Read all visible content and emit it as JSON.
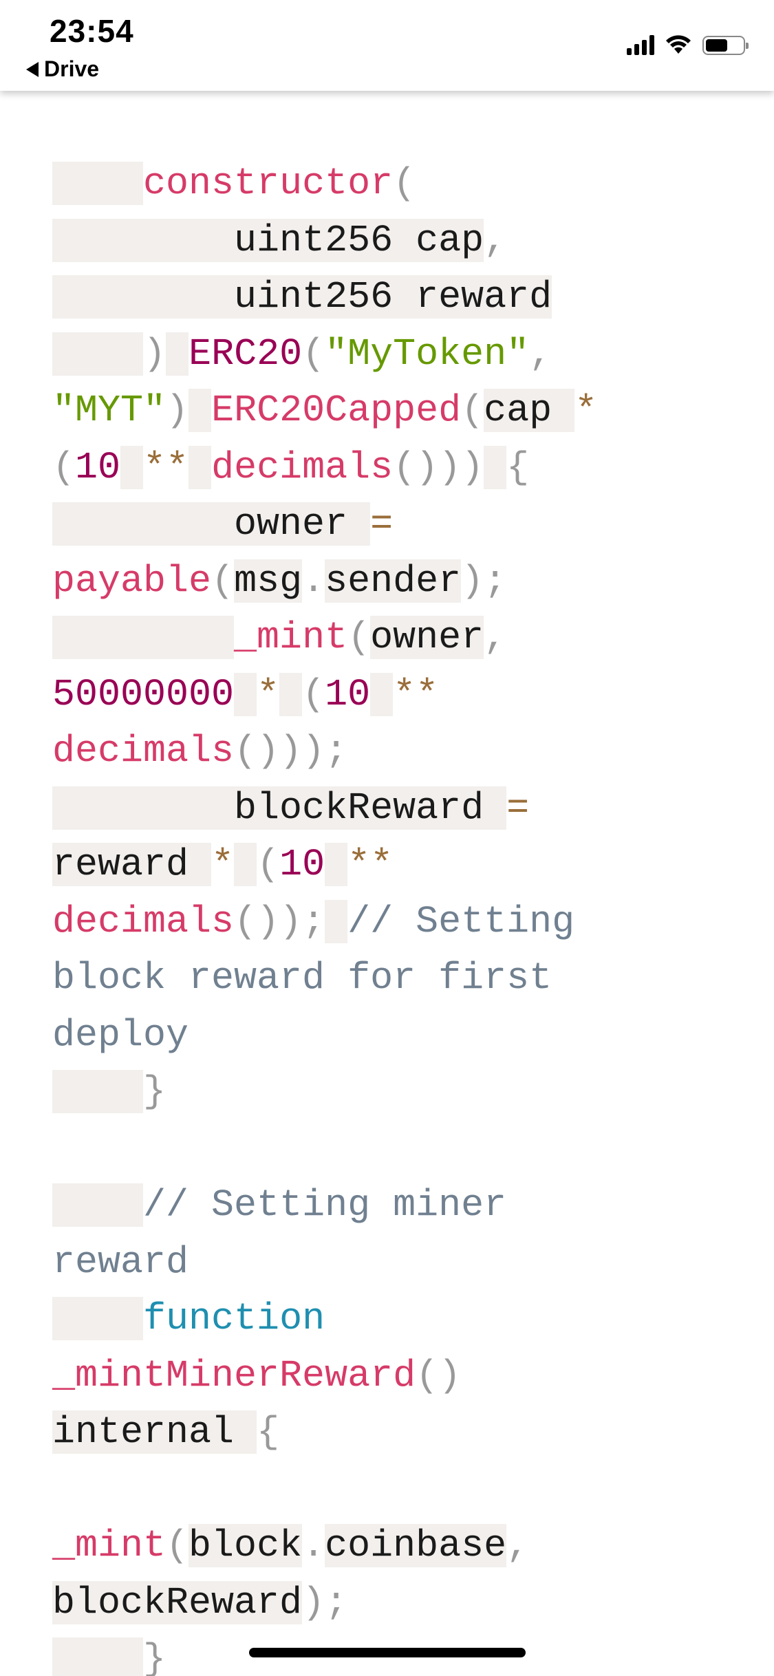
{
  "status_bar": {
    "time": "23:54",
    "back_label": "Drive",
    "signal_icon": "cellular-signal-icon",
    "wifi_icon": "wifi-icon",
    "battery_icon": "battery-icon",
    "battery_level": 0.6
  },
  "code_colors": {
    "function_name": "#d63b68",
    "number_and_contract": "#990055",
    "string": "#669900",
    "keyword": "#1f8fb0",
    "operator": "#9a6e3a",
    "comment": "#708090",
    "punctuation": "#999999",
    "whitespace_highlight": "#f2efec"
  },
  "code_lines": [
    [
      {
        "t": "    ",
        "c": "ws"
      },
      {
        "t": "constructor",
        "c": "k-red"
      },
      {
        "t": "(",
        "c": "k-p"
      }
    ],
    [
      {
        "t": "        uint256 cap",
        "c": "bg"
      },
      {
        "t": ",",
        "c": "k-p"
      }
    ],
    [
      {
        "t": "        uint256 reward",
        "c": "bg"
      }
    ],
    [
      {
        "t": "    ",
        "c": "ws"
      },
      {
        "t": ")",
        "c": "k-p"
      },
      {
        "t": " ",
        "c": "ws"
      },
      {
        "t": "ERC20",
        "c": "k-plum"
      },
      {
        "t": "(",
        "c": "k-p"
      },
      {
        "t": "\"MyToken\"",
        "c": "k-green"
      },
      {
        "t": ",",
        "c": "k-p"
      }
    ],
    [
      {
        "t": "\"MYT\"",
        "c": "k-green"
      },
      {
        "t": ")",
        "c": "k-p"
      },
      {
        "t": " ",
        "c": "ws"
      },
      {
        "t": "ERC20Capped",
        "c": "k-red"
      },
      {
        "t": "(",
        "c": "k-p"
      },
      {
        "t": "cap ",
        "c": "bg"
      },
      {
        "t": "*",
        "c": "k-op"
      }
    ],
    [
      {
        "t": "(",
        "c": "k-p"
      },
      {
        "t": "10",
        "c": "k-plum"
      },
      {
        "t": " ",
        "c": "ws"
      },
      {
        "t": "**",
        "c": "k-op"
      },
      {
        "t": " ",
        "c": "ws"
      },
      {
        "t": "decimals",
        "c": "k-red"
      },
      {
        "t": "()))",
        "c": "k-p"
      },
      {
        "t": " ",
        "c": "ws"
      },
      {
        "t": "{",
        "c": "k-p"
      }
    ],
    [
      {
        "t": "        owner ",
        "c": "bg"
      },
      {
        "t": "=",
        "c": "k-op"
      }
    ],
    [
      {
        "t": "payable",
        "c": "k-red"
      },
      {
        "t": "(",
        "c": "k-p"
      },
      {
        "t": "msg",
        "c": "bg"
      },
      {
        "t": ".",
        "c": "k-p"
      },
      {
        "t": "sender",
        "c": "bg"
      },
      {
        "t": ");",
        "c": "k-p"
      }
    ],
    [
      {
        "t": "        ",
        "c": "ws"
      },
      {
        "t": "_mint",
        "c": "k-red"
      },
      {
        "t": "(",
        "c": "k-p"
      },
      {
        "t": "owner",
        "c": "bg"
      },
      {
        "t": ",",
        "c": "k-p"
      }
    ],
    [
      {
        "t": "50000000",
        "c": "k-plum"
      },
      {
        "t": " ",
        "c": "ws"
      },
      {
        "t": "*",
        "c": "k-op"
      },
      {
        "t": " ",
        "c": "ws"
      },
      {
        "t": "(",
        "c": "k-p"
      },
      {
        "t": "10",
        "c": "k-plum"
      },
      {
        "t": " ",
        "c": "ws"
      },
      {
        "t": "**",
        "c": "k-op"
      }
    ],
    [
      {
        "t": "decimals",
        "c": "k-red"
      },
      {
        "t": "()));",
        "c": "k-p"
      }
    ],
    [
      {
        "t": "        blockReward ",
        "c": "bg"
      },
      {
        "t": "=",
        "c": "k-op"
      }
    ],
    [
      {
        "t": "reward ",
        "c": "bg"
      },
      {
        "t": "*",
        "c": "k-op"
      },
      {
        "t": " ",
        "c": "ws"
      },
      {
        "t": "(",
        "c": "k-p"
      },
      {
        "t": "10",
        "c": "k-plum"
      },
      {
        "t": " ",
        "c": "ws"
      },
      {
        "t": "**",
        "c": "k-op"
      }
    ],
    [
      {
        "t": "decimals",
        "c": "k-red"
      },
      {
        "t": "());",
        "c": "k-p"
      },
      {
        "t": " ",
        "c": "ws"
      },
      {
        "t": "// Setting",
        "c": "k-com"
      }
    ],
    [
      {
        "t": "block reward for first",
        "c": "k-com"
      }
    ],
    [
      {
        "t": "deploy",
        "c": "k-com"
      }
    ],
    [
      {
        "t": "    ",
        "c": "ws"
      },
      {
        "t": "}",
        "c": "k-p"
      }
    ],
    [],
    [
      {
        "t": "    ",
        "c": "ws"
      },
      {
        "t": "// Setting miner",
        "c": "k-com"
      }
    ],
    [
      {
        "t": "reward",
        "c": "k-com"
      }
    ],
    [
      {
        "t": "    ",
        "c": "ws"
      },
      {
        "t": "function",
        "c": "k-blue"
      }
    ],
    [
      {
        "t": "_mintMinerReward",
        "c": "k-red"
      },
      {
        "t": "()",
        "c": "k-p"
      }
    ],
    [
      {
        "t": "internal ",
        "c": "bg"
      },
      {
        "t": "{",
        "c": "k-p"
      }
    ],
    [],
    [
      {
        "t": "_mint",
        "c": "k-red"
      },
      {
        "t": "(",
        "c": "k-p"
      },
      {
        "t": "block",
        "c": "bg"
      },
      {
        "t": ".",
        "c": "k-p"
      },
      {
        "t": "coinbase",
        "c": "bg"
      },
      {
        "t": ",",
        "c": "k-p"
      }
    ],
    [
      {
        "t": "blockReward",
        "c": "bg"
      },
      {
        "t": ");",
        "c": "k-p"
      }
    ],
    [
      {
        "t": "    ",
        "c": "ws"
      },
      {
        "t": "}",
        "c": "k-p"
      }
    ]
  ]
}
